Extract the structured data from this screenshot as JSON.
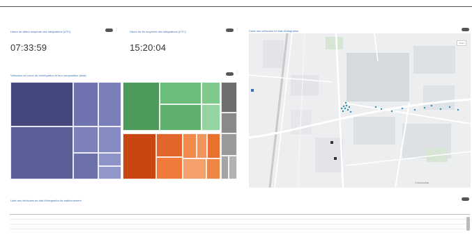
{
  "header": {
    "title": ""
  },
  "kpi_first": {
    "title": "Heure de début moyenne des intégrations (UTC)",
    "value": "07:33:59"
  },
  "kpi_last": {
    "title": "Heure de fin moyenne des intégrations (UTC)",
    "value": "15:20:04"
  },
  "map_panel": {
    "title": "Carte des véhicules en état d'intégration",
    "zoom_label": "Zoom",
    "labels": [],
    "attribution": "© OpenStreetMap"
  },
  "treemap": {
    "title": "Véhicules en cours de réintégration et leur composition (total)",
    "groups": [
      {
        "color": "#5a5f98",
        "tiles": [
          {
            "value": 35
          },
          {
            "value": 14
          },
          {
            "value": 12
          },
          {
            "value": 26
          },
          {
            "value": 10
          },
          {
            "value": 8
          },
          {
            "value": 7
          },
          {
            "value": 6
          },
          {
            "value": 5
          }
        ]
      },
      {
        "color": "#4f9a5c",
        "tiles": [
          {
            "value": 18
          },
          {
            "value": 16
          },
          {
            "value": 7
          },
          {
            "value": 4
          }
        ]
      },
      {
        "color": "#e2652a",
        "tiles": [
          {
            "value": 14
          },
          {
            "value": 10
          },
          {
            "value": 8
          },
          {
            "value": 6
          },
          {
            "value": 5
          },
          {
            "value": 4
          }
        ]
      },
      {
        "color": "#777777",
        "tiles": [
          {
            "value": 6
          },
          {
            "value": 4
          },
          {
            "value": 3
          }
        ]
      }
    ]
  },
  "table": {
    "title": "Liste des véhicules en état d'intégration de stationnement",
    "pager": "",
    "columns": [
      "",
      "",
      "",
      "",
      "",
      ""
    ],
    "rows": [
      [
        "",
        "",
        "",
        "",
        "",
        ""
      ],
      [
        "",
        "",
        "",
        "",
        "",
        ""
      ],
      [
        "",
        "",
        "",
        "",
        "",
        ""
      ]
    ]
  }
}
